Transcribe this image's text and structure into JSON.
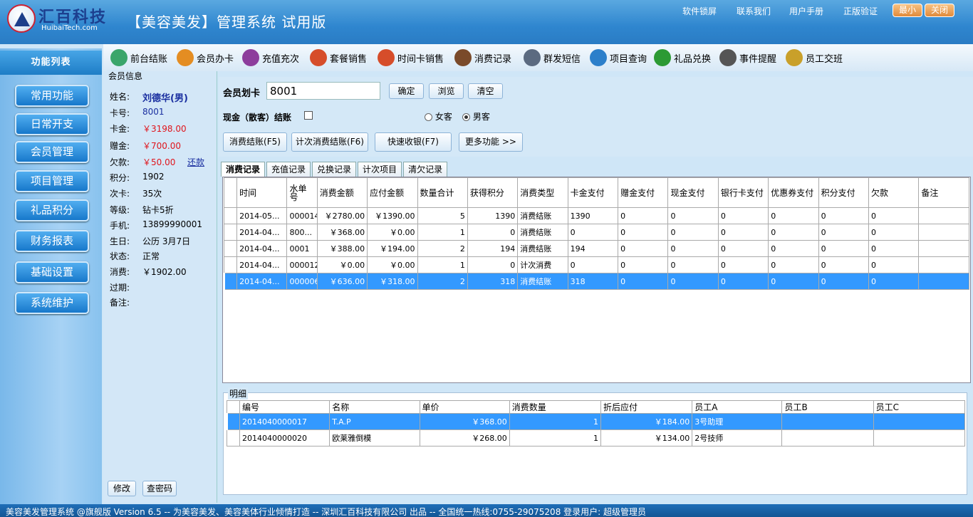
{
  "header": {
    "logo_name": "汇百科技",
    "logo_sub": "HuibaiTech.com",
    "app_title": "【美容美发】管理系统 试用版",
    "links": [
      "软件锁屏",
      "联系我们",
      "用户手册",
      "正版验证"
    ],
    "btn_min": "最小",
    "btn_close": "关闭"
  },
  "toolbar": [
    {
      "label": "前台结账",
      "icon": "yen-coin-icon",
      "color": "#3aa56a"
    },
    {
      "label": "会员办卡",
      "icon": "user-card-icon",
      "color": "#e48d22"
    },
    {
      "label": "充值充次",
      "icon": "euro-coin-icon",
      "color": "#8d3d9c"
    },
    {
      "label": "套餐销售",
      "icon": "cart-icon",
      "color": "#d64d2a"
    },
    {
      "label": "时间卡销售",
      "icon": "cart-time-icon",
      "color": "#d64d2a"
    },
    {
      "label": "消费记录",
      "icon": "notebook-icon",
      "color": "#7a4a2a"
    },
    {
      "label": "群发短信",
      "icon": "phone-icon",
      "color": "#5b6a80"
    },
    {
      "label": "项目查询",
      "icon": "magnifier-icon",
      "color": "#2c7fca"
    },
    {
      "label": "礼品兑换",
      "icon": "gift-icon",
      "color": "#2c9a34"
    },
    {
      "label": "事件提醒",
      "icon": "alarm-icon",
      "color": "#555555"
    },
    {
      "label": "员工交班",
      "icon": "pencil-icon",
      "color": "#c9a02a"
    }
  ],
  "sidebar": {
    "title": "功能列表",
    "items": [
      "常用功能",
      "日常开支",
      "会员管理",
      "项目管理",
      "礼品积分",
      "财务报表",
      "基础设置",
      "系统维护"
    ]
  },
  "member": {
    "title": "会员信息",
    "rows": [
      {
        "k": "姓名:",
        "v": "刘德华(男)"
      },
      {
        "k": "卡号:",
        "v": "8001"
      },
      {
        "k": "卡金:",
        "v": "￥3198.00"
      },
      {
        "k": "赠金:",
        "v": "￥700.00"
      },
      {
        "k": "欠款:",
        "v": "￥50.00"
      },
      {
        "k": "积分:",
        "v": "1902"
      },
      {
        "k": "次卡:",
        "v": "35次"
      },
      {
        "k": "等级:",
        "v": "钻卡5折"
      },
      {
        "k": "手机:",
        "v": "13899990001"
      },
      {
        "k": "生日:",
        "v": "公历 3月7日"
      },
      {
        "k": "状态:",
        "v": "正常"
      },
      {
        "k": "消费:",
        "v": "￥1902.00"
      },
      {
        "k": "过期:",
        "v": ""
      },
      {
        "k": "备注:",
        "v": ""
      }
    ],
    "repay": "还款",
    "btn_edit": "修改",
    "btn_pwd": "查密码"
  },
  "swipe": {
    "label": "会员划卡",
    "value": "8001",
    "btn_ok": "确定",
    "btn_browse": "浏览",
    "btn_clear": "清空",
    "cash_label": "现金（散客）结账",
    "female": "女客",
    "male": "男客",
    "actions": [
      "消费结账(F5)",
      "计次消费结账(F6)",
      "快速收银(F7)",
      "更多功能 >>"
    ]
  },
  "tabs": [
    "消费记录",
    "充值记录",
    "兑换记录",
    "计次项目",
    "清欠记录"
  ],
  "records": {
    "columns": [
      "时间",
      "水单号",
      "消费金额",
      "应付金额",
      "数量合计",
      "获得积分",
      "消费类型",
      "卡金支付",
      "赠金支付",
      "现金支付",
      "银行卡支付",
      "优惠券支付",
      "积分支付",
      "欠款",
      "备注"
    ],
    "rows": [
      [
        "2014-05...",
        "000014",
        "￥2780.00",
        "￥1390.00",
        "5",
        "1390",
        "消费结账",
        "1390",
        "0",
        "0",
        "0",
        "0",
        "0",
        "0",
        ""
      ],
      [
        "2014-04...",
        "800...",
        "￥368.00",
        "￥0.00",
        "1",
        "0",
        "消费结账",
        "0",
        "0",
        "0",
        "0",
        "0",
        "0",
        "0",
        ""
      ],
      [
        "2014-04...",
        "0001",
        "￥388.00",
        "￥194.00",
        "2",
        "194",
        "消费结账",
        "194",
        "0",
        "0",
        "0",
        "0",
        "0",
        "0",
        ""
      ],
      [
        "2014-04...",
        "000012",
        "￥0.00",
        "￥0.00",
        "1",
        "0",
        "计次消费",
        "0",
        "0",
        "0",
        "0",
        "0",
        "0",
        "0",
        ""
      ],
      [
        "2014-04...",
        "000006",
        "￥636.00",
        "￥318.00",
        "2",
        "318",
        "消费结账",
        "318",
        "0",
        "0",
        "0",
        "0",
        "0",
        "0",
        ""
      ]
    ],
    "selected": 4
  },
  "detail": {
    "title": "明细",
    "columns": [
      "编号",
      "名称",
      "单价",
      "消费数量",
      "折后应付",
      "员工A",
      "员工B",
      "员工C"
    ],
    "rows": [
      [
        "2014040000017",
        "T.A.P",
        "￥368.00",
        "1",
        "￥184.00",
        "3号助理",
        "",
        ""
      ],
      [
        "2014040000020",
        "欧莱雅倒模",
        "￥268.00",
        "1",
        "￥134.00",
        "2号技师",
        "",
        ""
      ]
    ],
    "selected": 0
  },
  "status": "美容美发管理系统 @旗舰版 Version 6.5 -- 为美容美发、美容美体行业倾情打造 -- 深圳汇百科技有限公司 出品 -- 全国统一热线:0755-29075208          登录用户: 超级管理员"
}
